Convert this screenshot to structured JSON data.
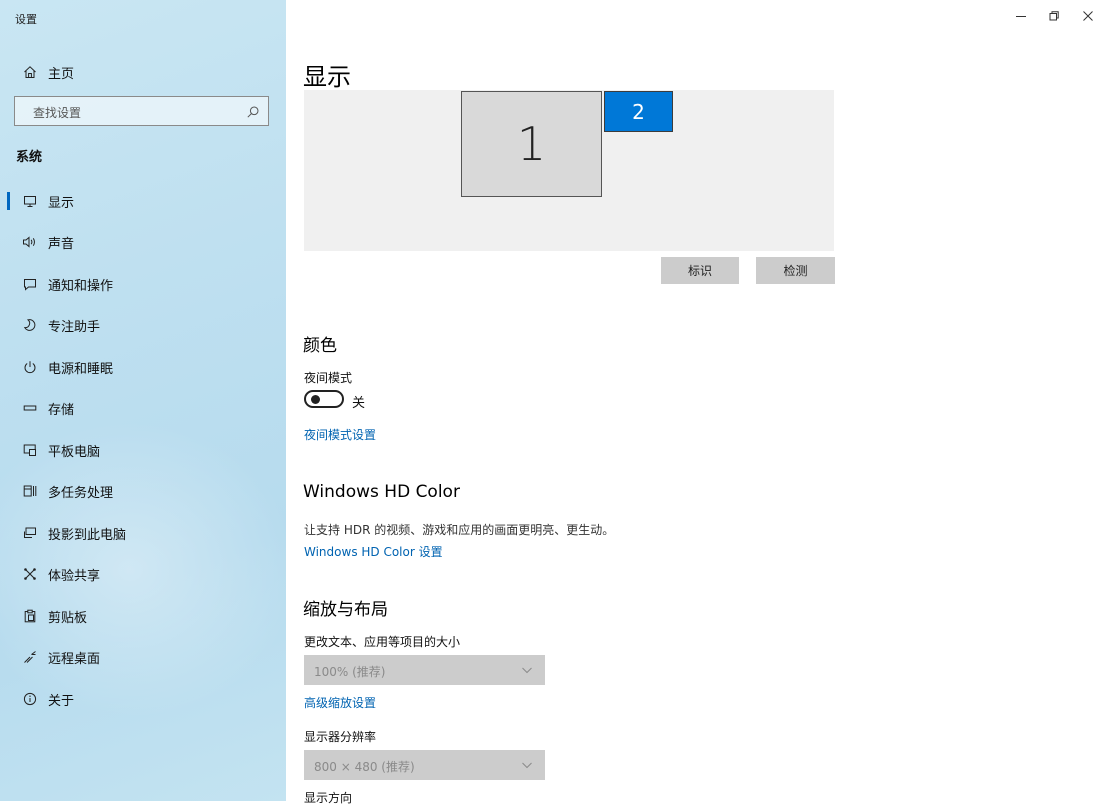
{
  "window": {
    "title": "设置",
    "controls": {
      "minimize": "–",
      "restore": "❐",
      "close": "×"
    }
  },
  "sidebar": {
    "home_label": "主页",
    "search": {
      "placeholder": "查找设置"
    },
    "section_header": "系统",
    "items": [
      {
        "label": "显示",
        "icon": "monitor-icon",
        "active": true
      },
      {
        "label": "声音",
        "icon": "speaker-icon"
      },
      {
        "label": "通知和操作",
        "icon": "notification-icon"
      },
      {
        "label": "专注助手",
        "icon": "moon-icon"
      },
      {
        "label": "电源和睡眠",
        "icon": "power-icon"
      },
      {
        "label": "存储",
        "icon": "storage-icon"
      },
      {
        "label": "平板电脑",
        "icon": "tablet-icon"
      },
      {
        "label": "多任务处理",
        "icon": "multitask-icon"
      },
      {
        "label": "投影到此电脑",
        "icon": "project-icon"
      },
      {
        "label": "体验共享",
        "icon": "share-icon"
      },
      {
        "label": "剪贴板",
        "icon": "clipboard-icon"
      },
      {
        "label": "远程桌面",
        "icon": "remote-desktop-icon"
      },
      {
        "label": "关于",
        "icon": "info-icon"
      }
    ]
  },
  "main": {
    "title": "显示",
    "monitors": {
      "primary": "1",
      "secondary": "2"
    },
    "identify_button": "标识",
    "detect_button": "检测",
    "color": {
      "heading": "颜色",
      "night_light_label": "夜间模式",
      "night_light_state": "关",
      "night_light_on": false,
      "night_light_settings_link": "夜间模式设置"
    },
    "hdr": {
      "heading": "Windows HD Color",
      "description": "让支持 HDR 的视频、游戏和应用的画面更明亮、更生动。",
      "settings_link": "Windows HD Color 设置"
    },
    "scale": {
      "heading": "缩放与布局",
      "size_label": "更改文本、应用等项目的大小",
      "size_value": "100% (推荐)",
      "advanced_link": "高级缩放设置",
      "resolution_label": "显示器分辨率",
      "resolution_value": "800 × 480 (推荐)",
      "orientation_label": "显示方向"
    }
  },
  "colors": {
    "accent": "#0078d7",
    "link": "#0063b1",
    "sidebar_bg": "#bfe0f0"
  }
}
